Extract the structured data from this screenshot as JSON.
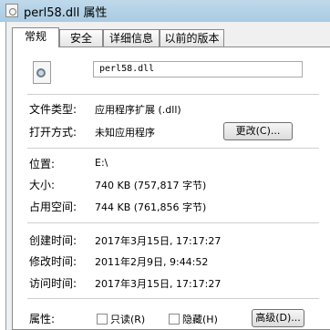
{
  "window": {
    "title": "perl58.dll 属性"
  },
  "tabs": [
    {
      "label": "常规"
    },
    {
      "label": "安全"
    },
    {
      "label": "详细信息"
    },
    {
      "label": "以前的版本"
    }
  ],
  "general": {
    "file_name": "perl58.dll",
    "file_type_label": "文件类型:",
    "file_type_value": "应用程序扩展 (.dll)",
    "opens_with_label": "打开方式:",
    "opens_with_value": "未知应用程序",
    "change_button": "更改(C)...",
    "location_label": "位置:",
    "location_value": "E:\\",
    "size_label": "大小:",
    "size_value": "740 KB (757,817 字节)",
    "size_on_disk_label": "占用空间:",
    "size_on_disk_value": "744 KB (761,856 字节)",
    "created_label": "创建时间:",
    "created_value": "2017年3月15日, 17:17:27",
    "modified_label": "修改时间:",
    "modified_value": "2011年2月9日, 9:44:52",
    "accessed_label": "访问时间:",
    "accessed_value": "2017年3月15日, 17:17:27",
    "attributes_label": "属性:",
    "readonly_label": "只读(R)",
    "hidden_label": "隐藏(H)",
    "advanced_button": "高级(D)..."
  }
}
